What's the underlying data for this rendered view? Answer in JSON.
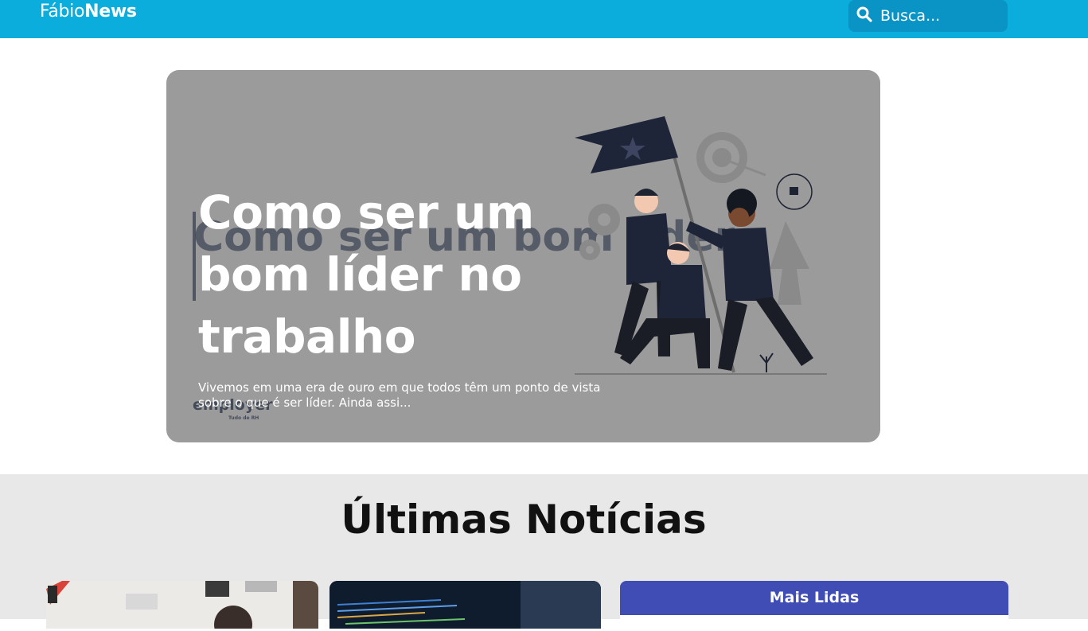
{
  "header": {
    "logo_light": "Fábio",
    "logo_bold": "News",
    "search_placeholder": "Busca..."
  },
  "hero": {
    "title": "Como ser um bom líder no trabalho",
    "excerpt": "Vivemos em uma era de ouro em que todos têm um ponto de vista sobre o que é ser líder. Ainda assi...",
    "image_text": {
      "title": "Como ser um bom líder",
      "brand": "employer",
      "brand_sub": "Tudo de RH"
    }
  },
  "latest": {
    "heading": "Últimas Notícias",
    "most_read_label": "Mais Lidas"
  },
  "colors": {
    "header_bg": "#0aaddb",
    "search_bg": "#0a93c5",
    "hero_overlay": "#9b9b9b",
    "section_bg": "#e8e8e8",
    "most_read_bg": "#3f4db5"
  }
}
